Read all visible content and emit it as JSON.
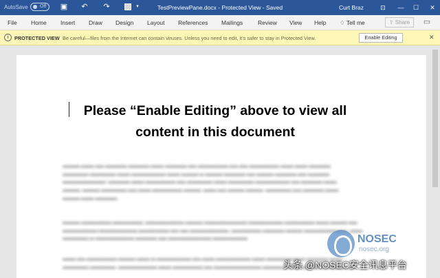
{
  "titlebar": {
    "autosave_label": "AutoSave",
    "autosave_state": "Off",
    "document_title": "TestPreviewPane.docx  -  Protected View  -  Saved",
    "user_name": "Curt Braz",
    "icons": [
      "save-icon",
      "undo-icon",
      "redo-icon",
      "color-swatch-icon",
      "customize-dropdown-icon",
      "ribbon-display-icon",
      "minimize-icon",
      "maximize-icon",
      "close-icon"
    ]
  },
  "ribbon": {
    "tabs": [
      "File",
      "Home",
      "Insert",
      "Draw",
      "Design",
      "Layout",
      "References",
      "Mailings",
      "Review",
      "View",
      "Help"
    ],
    "tell_me": "Tell me",
    "share": "Share"
  },
  "protected_view": {
    "label": "PROTECTED VIEW",
    "message": "Be careful—files from the Internet can contain viruses. Unless you need to edit, it's safer to stay in Protected View.",
    "button": "Enable Editing"
  },
  "document": {
    "heading_line1": "Please “Enable Editing” above to view all",
    "heading_line2": "content in this document"
  },
  "watermark": {
    "brand": "NOSEC",
    "site": "nosec.org",
    "caption": "头条 @NOSEC安全讯息平台",
    "faint": "NOSEC"
  },
  "colors": {
    "titlebar": "#2b579a",
    "protected_bar": "#fcf7b6"
  }
}
